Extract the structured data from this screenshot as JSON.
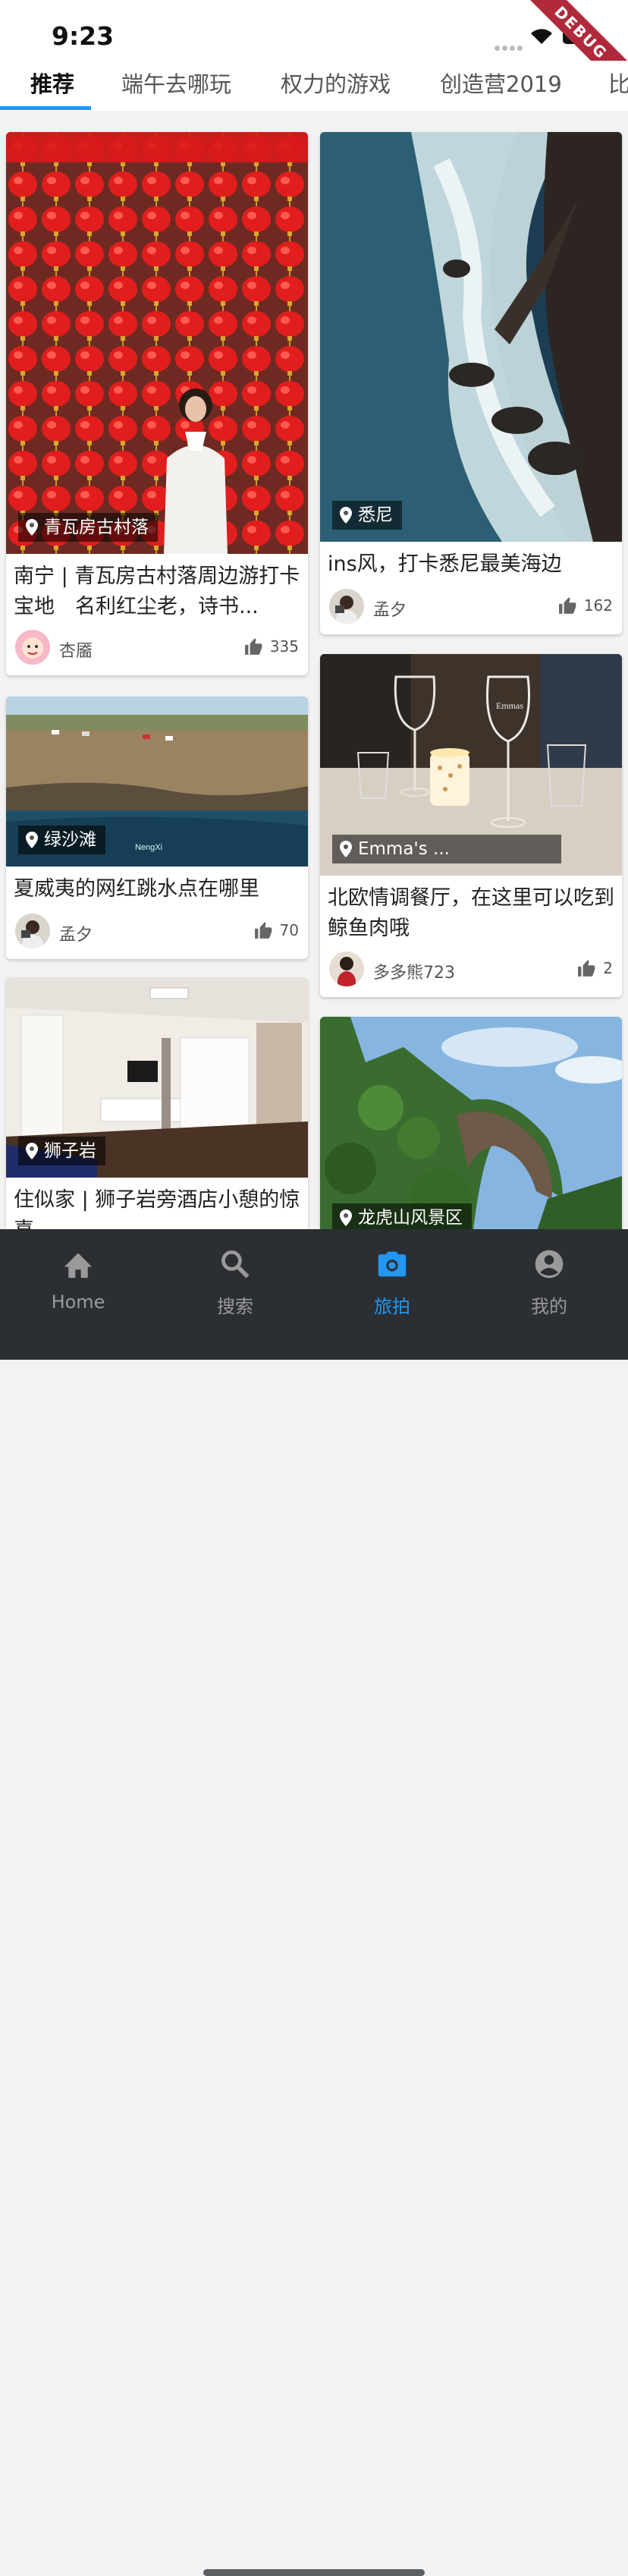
{
  "status": {
    "time": "9:23",
    "debug_label": "DEBUG"
  },
  "tabs": [
    {
      "label": "推荐",
      "active": true
    },
    {
      "label": "端午去哪玩"
    },
    {
      "label": "权力的游戏"
    },
    {
      "label": "创造营2019"
    },
    {
      "label": "比"
    }
  ],
  "colors": {
    "accent": "#2196f3",
    "nav_bg": "#2b2e33",
    "indicator": "#2196f3"
  },
  "cards": [
    {
      "location": "青瓦房古村落",
      "title": "南宁 | 青瓦房古村落周边游打卡宝地　名利红尘老，诗书...",
      "author": "杏靥",
      "likes": "335"
    },
    {
      "location": "悉尼",
      "title": "ins风，打卡悉尼最美海边",
      "author": "孟夕",
      "likes": "162"
    },
    {
      "location": "绿沙滩",
      "title": "夏威夷的网红跳水点在哪里",
      "author": "孟夕",
      "likes": "70",
      "watermark": "NengXi"
    },
    {
      "location": "Emma's ...",
      "title": "北欧情调餐厅，在这里可以吃到鲸鱼肉哦",
      "author": "多多熊723",
      "likes": "2",
      "glass_text": "Emmas"
    },
    {
      "location": "狮子岩",
      "title": "住似家 | 狮子岩旁酒店小憩的惊喜"
    },
    {
      "location": "龙虎山风景区"
    }
  ],
  "nav": [
    {
      "label": "Home",
      "icon": "home-icon"
    },
    {
      "label": "搜索",
      "icon": "search-icon"
    },
    {
      "label": "旅拍",
      "icon": "camera-icon",
      "active": true
    },
    {
      "label": "我的",
      "icon": "account-icon"
    }
  ]
}
